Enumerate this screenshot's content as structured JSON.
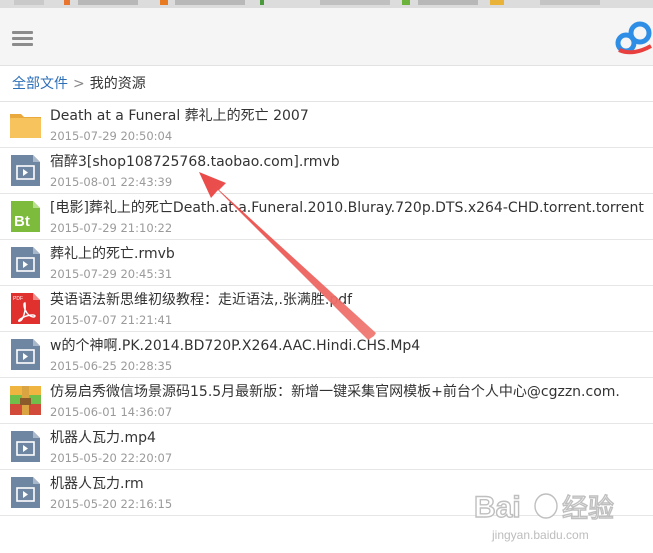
{
  "breadcrumb": {
    "home": "全部文件",
    "separator": ">",
    "current": "我的资源"
  },
  "files": [
    {
      "icon": "folder-icon",
      "name": "Death at a Funeral 葬礼上的死亡 2007",
      "time": "2015-07-29 20:50:04"
    },
    {
      "icon": "video-file-icon",
      "name": "宿醉3[shop108725768.taobao.com].rmvb",
      "time": "2015-08-01 22:43:39"
    },
    {
      "icon": "torrent-file-icon",
      "name": "[电影]葬礼上的死亡Death.at.a.Funeral.2010.Bluray.720p.DTS.x264-CHD.torrent.torrent",
      "time": "2015-07-29 21:10:22"
    },
    {
      "icon": "video-file-icon",
      "name": "葬礼上的死亡.rmvb",
      "time": "2015-07-29 20:45:31"
    },
    {
      "icon": "pdf-file-icon",
      "name": "英语语法新思维初级教程：走近语法,.张满胜.pdf",
      "time": "2015-07-07 21:21:41"
    },
    {
      "icon": "video-file-icon",
      "name": "w的个神啊.PK.2014.BD720P.X264.AAC.Hindi.CHS.Mp4",
      "time": "2015-06-25 20:28:35"
    },
    {
      "icon": "archive-file-icon",
      "name": "仿易启秀微信场景源码15.5月最新版：新增一键采集官网模板+前台个人中心@cgzzn.com.",
      "time": "2015-06-01 14:36:07"
    },
    {
      "icon": "video-file-icon",
      "name": "机器人瓦力.mp4",
      "time": "2015-05-20 22:20:07"
    },
    {
      "icon": "video-file-icon",
      "name": "机器人瓦力.rm",
      "time": "2015-05-20 22:16:15"
    }
  ],
  "colors": {
    "link": "#2d6fb7",
    "folder": "#f7c35c",
    "video": "#6f86a3",
    "torrent": "#7dbb3c",
    "pdf": "#e0312f",
    "arrow": "#e8403e"
  }
}
